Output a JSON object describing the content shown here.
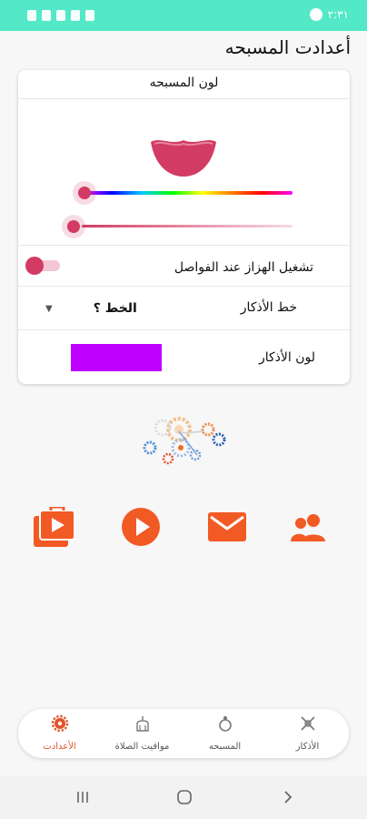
{
  "status_bar": {
    "time": "٢:٣١"
  },
  "page_title": "أعدادت المسبحه",
  "tasbeeh_color_card": {
    "title": "لون المسبحه"
  },
  "vibration_row": {
    "label": "تشغيل الهزاز عند الفواصل",
    "enabled": true
  },
  "font_row": {
    "label": "خط الأذكار",
    "selected": "الخط ؟"
  },
  "azkar_color_row": {
    "label": "لون الأذكار",
    "color": "#c000ff"
  },
  "bead_color": "#d23b64",
  "accent_color": "#e2532a",
  "action_icons": [
    "people-icon",
    "mail-icon",
    "play-icon",
    "app-store-icon"
  ],
  "bottom_nav": {
    "items": [
      {
        "label": "الأذكار",
        "icon": "azkar-icon"
      },
      {
        "label": "المسبحه",
        "icon": "tasbeeh-icon"
      },
      {
        "label": "مواقيت الصلاة",
        "icon": "mosque-icon"
      },
      {
        "label": "الأعدادت",
        "icon": "settings-gear-icon"
      }
    ]
  }
}
